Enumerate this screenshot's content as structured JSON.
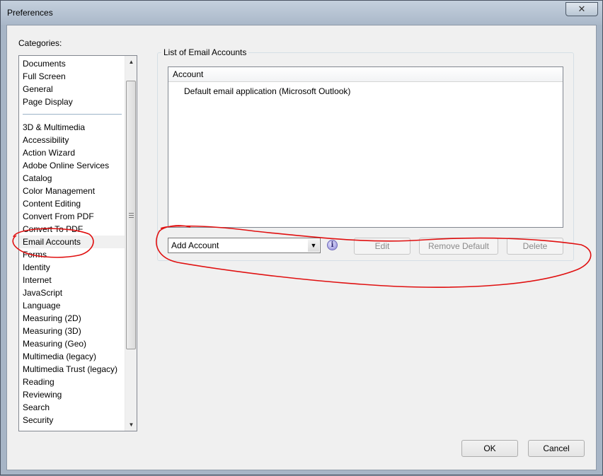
{
  "window": {
    "title": "Preferences",
    "close_glyph": "✕"
  },
  "categories": {
    "label": "Categories:",
    "items": [
      "Documents",
      "Full Screen",
      "General",
      "Page Display",
      "3D & Multimedia",
      "Accessibility",
      "Action Wizard",
      "Adobe Online Services",
      "Catalog",
      "Color Management",
      "Content Editing",
      "Convert From PDF",
      "Convert To PDF",
      "Email Accounts",
      "Forms",
      "Identity",
      "Internet",
      "JavaScript",
      "Language",
      "Measuring (2D)",
      "Measuring (3D)",
      "Measuring (Geo)",
      "Multimedia (legacy)",
      "Multimedia Trust (legacy)",
      "Reading",
      "Reviewing",
      "Search",
      "Security"
    ],
    "selected": "Email Accounts"
  },
  "email": {
    "group_title": "List of Email Accounts",
    "column_header": "Account",
    "rows": [
      "Default email application (Microsoft Outlook)"
    ],
    "add_account_value": "Add Account",
    "edit_label": "Edit",
    "remove_default_label": "Remove Default",
    "delete_label": "Delete",
    "info_glyph": "i"
  },
  "footer": {
    "ok_label": "OK",
    "cancel_label": "Cancel"
  },
  "colors": {
    "annotation": "#e01010",
    "list_divider": "#9db3c8"
  },
  "icons": [
    "close-icon",
    "scroll-up-icon",
    "scroll-down-icon",
    "dropdown-arrow-icon",
    "info-icon"
  ]
}
